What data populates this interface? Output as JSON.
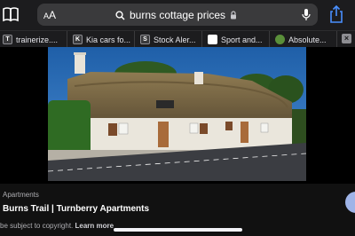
{
  "toolbar": {
    "aa_small": "A",
    "aa_large": "A",
    "bookmarks_icon": "book-icon",
    "share_icon": "share-icon"
  },
  "address": {
    "url_text": "burns cottage prices",
    "search_icon": "magnifier-icon",
    "lock_icon": "padlock-icon",
    "mic_icon": "microphone-icon"
  },
  "tabs": [
    {
      "label": "trainerize....",
      "favicon_text": "T",
      "favicon_color": "#3a3a3c"
    },
    {
      "label": "Kia cars fo...",
      "favicon_text": "K",
      "favicon_color": "#3a3a3c"
    },
    {
      "label": "Stock Aler...",
      "favicon_text": "S",
      "favicon_color": "#3a3a3c"
    },
    {
      "label": "Sport and...",
      "favicon_text": "",
      "favicon_color": "#ffffff"
    },
    {
      "label": "Absolute...",
      "favicon_text": "",
      "favicon_color": "#5a8f3a"
    }
  ],
  "tab_close_label": "×",
  "result": {
    "source": "Apartments",
    "title": "Burns Trail | Turnberry Apartments",
    "copyright": "be subject to copyright.",
    "learn_more": "Learn more"
  },
  "colors": {
    "toolbar_bg": "#1c1c1e",
    "address_bg": "#3a3a3c",
    "accent_blue": "#9fb4e8"
  }
}
